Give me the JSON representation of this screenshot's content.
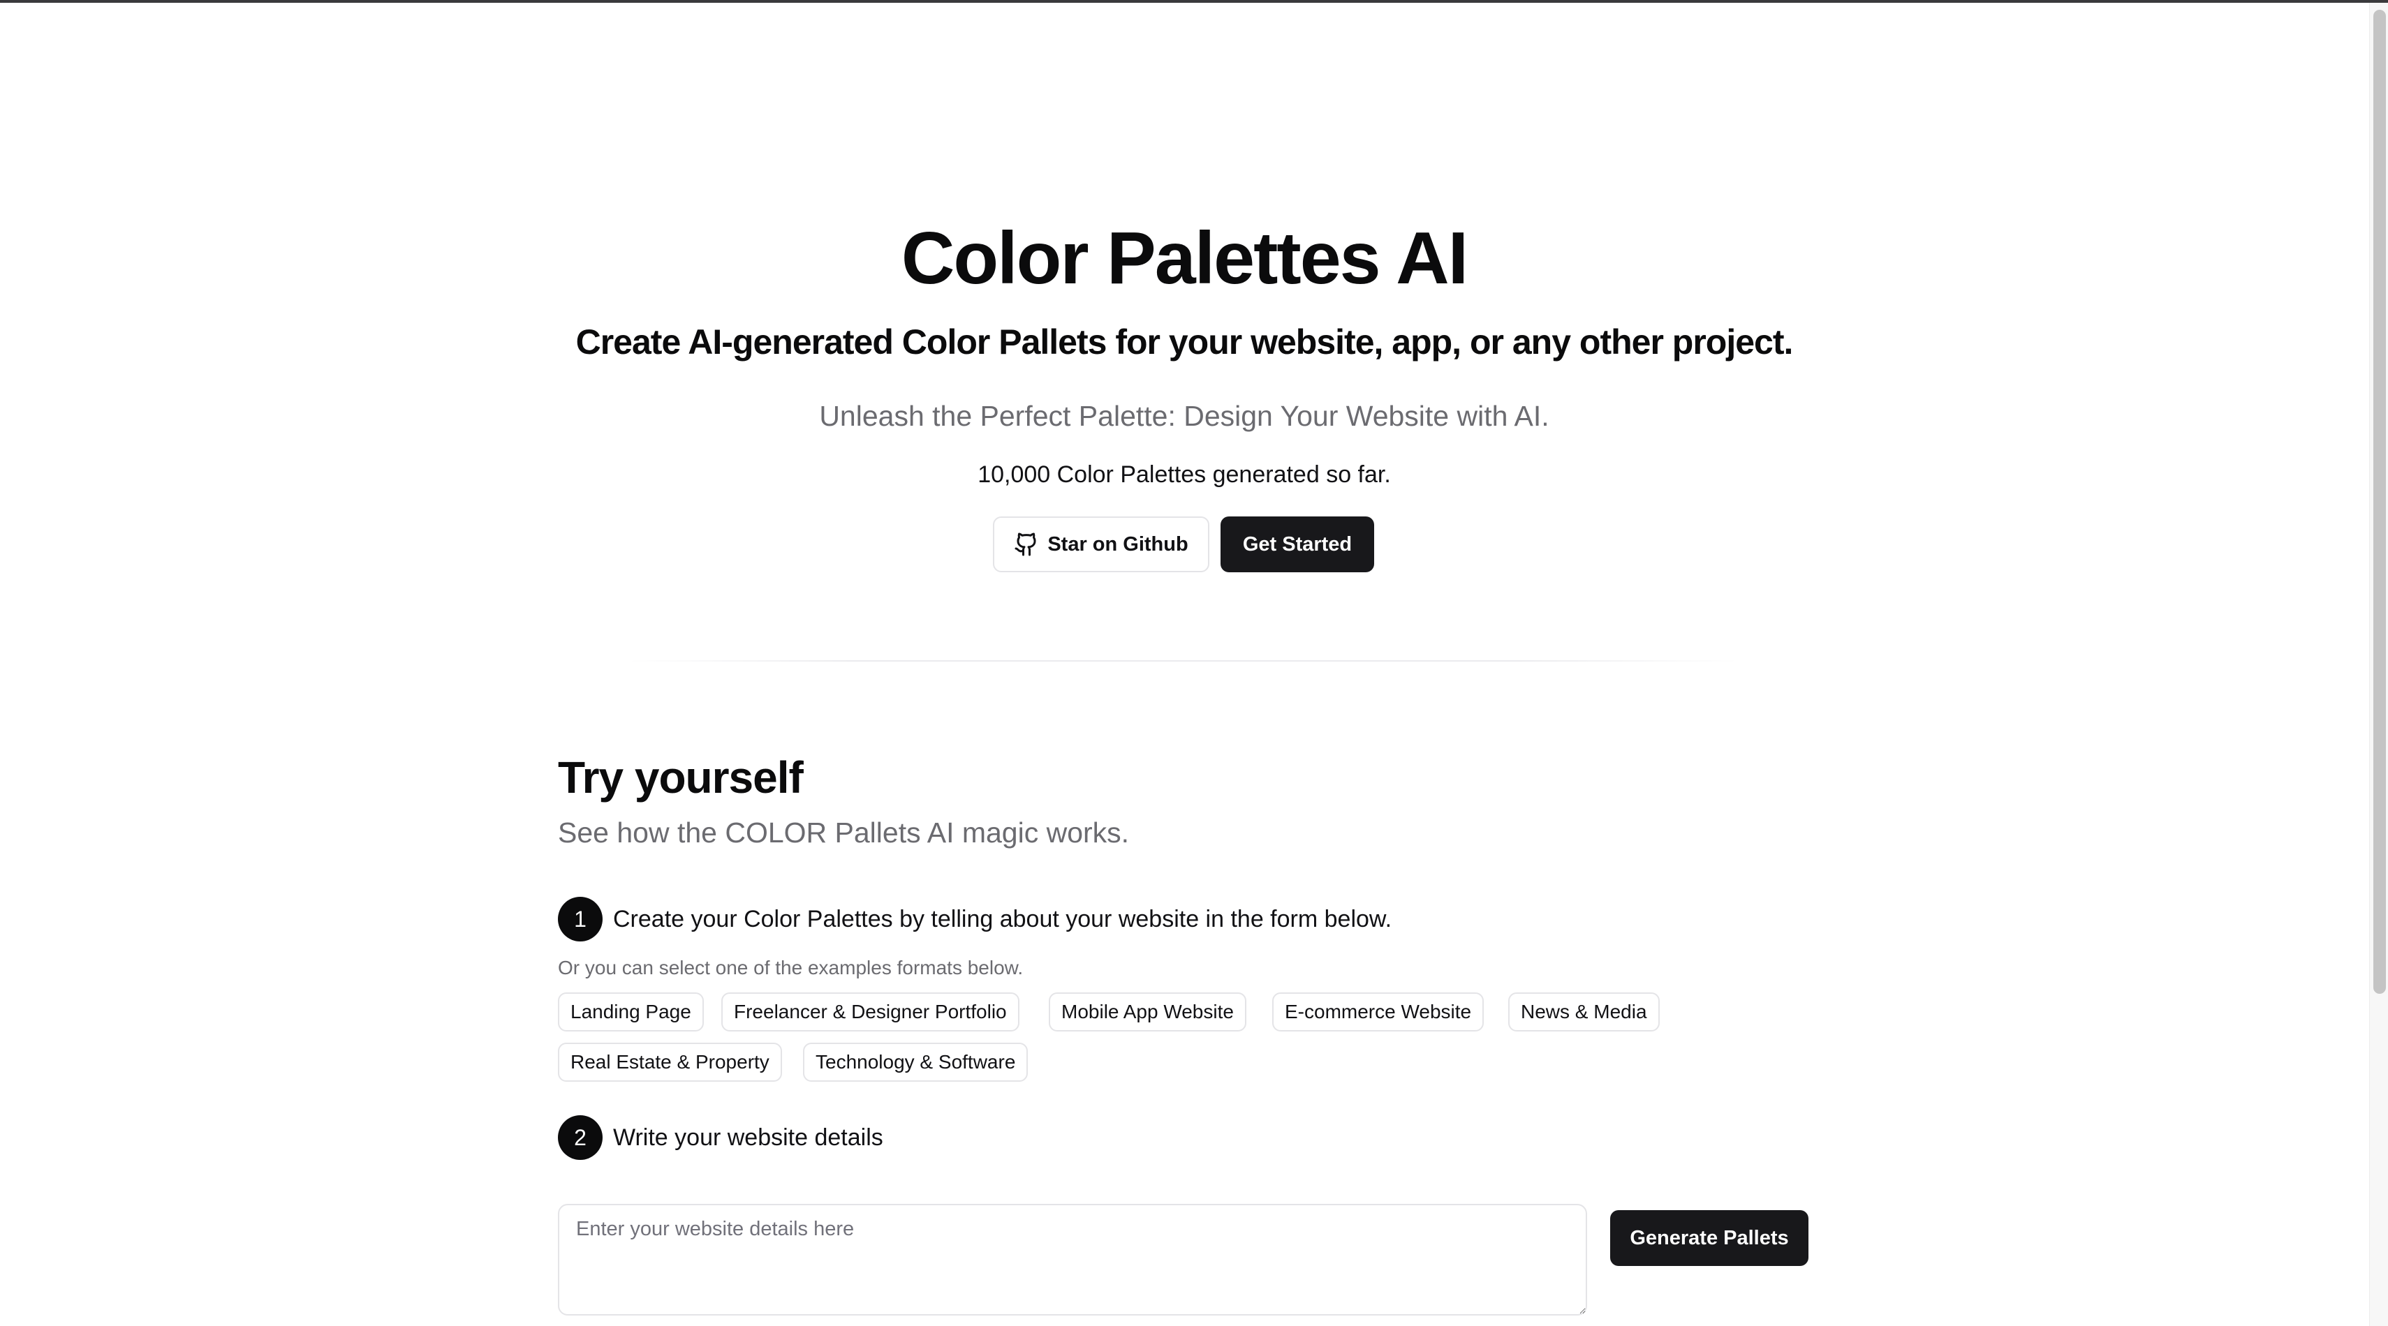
{
  "hero": {
    "title": "Color Palettes AI",
    "subtitle": "Create AI-generated Color Pallets for your website, app, or any other project.",
    "tagline": "Unleash the Perfect Palette: Design Your Website with AI.",
    "counter_text": "10,000 Color Palettes generated so far.",
    "github_button_label": "Star on Github",
    "github_icon": "github-icon",
    "get_started_label": "Get Started"
  },
  "try_section": {
    "title": "Try yourself",
    "subtitle": "See how the COLOR Pallets AI magic works.",
    "step1": {
      "number": "1",
      "text": "Create your Color Palettes by telling about your website in the form below."
    },
    "examples_hint": "Or you can select one of the examples formats below.",
    "examples": [
      "Landing Page",
      "Freelancer & Designer Portfolio",
      "Mobile App Website",
      "E-commerce Website",
      "News & Media",
      "Real Estate & Property",
      "Technology & Software"
    ],
    "step2": {
      "number": "2",
      "text": "Write your website details"
    },
    "details_input": {
      "value": "",
      "placeholder": "Enter your website details here"
    },
    "generate_button_label": "Generate Pallets"
  },
  "colors": {
    "primary_dark": "#18181b",
    "muted_text": "#6b6b70",
    "border": "#e4e4e7",
    "background": "#ffffff"
  }
}
